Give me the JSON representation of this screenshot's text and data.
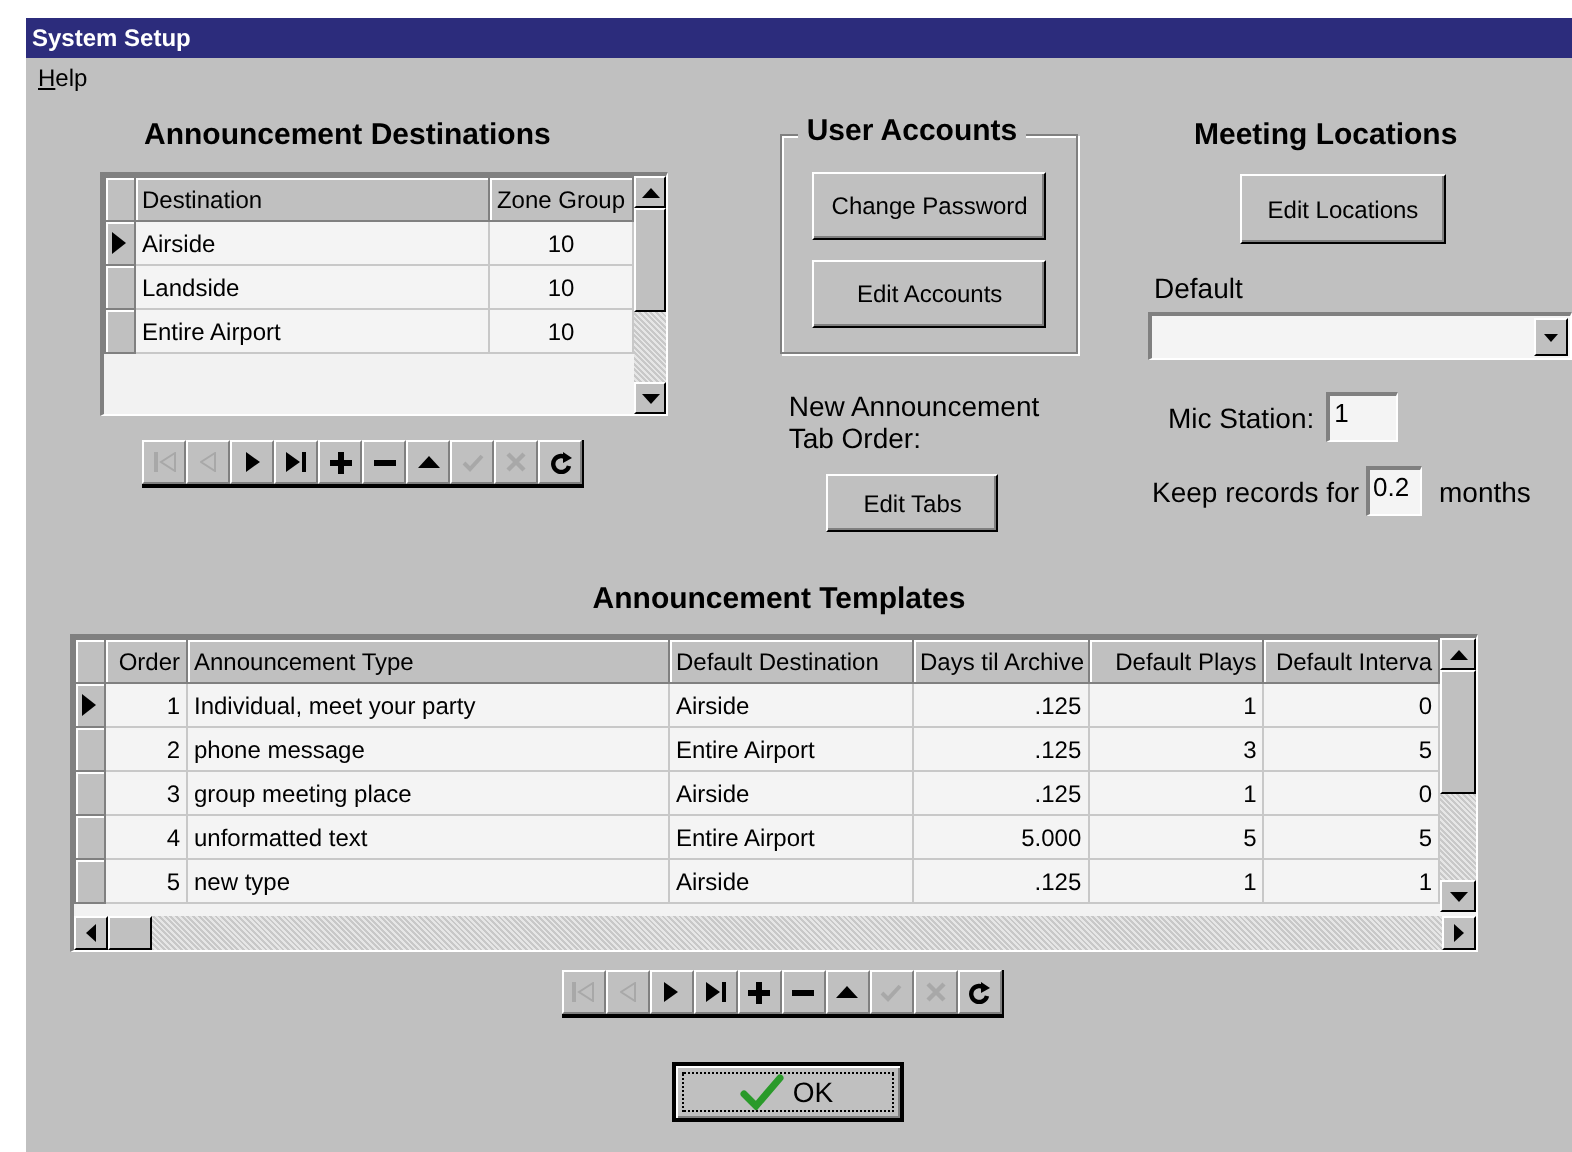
{
  "window": {
    "title": "System Setup"
  },
  "menu": [
    {
      "label": "Help"
    }
  ],
  "destinations": {
    "title": "Announcement Destinations",
    "columns": [
      {
        "label": "Destination",
        "kind": "text"
      },
      {
        "label": "Zone Group",
        "kind": "code"
      }
    ],
    "rows": [
      {
        "cells": [
          "Airside",
          "10"
        ],
        "selected": true
      },
      {
        "cells": [
          "Landside",
          "10"
        ],
        "selected": false
      },
      {
        "cells": [
          "Entire Airport",
          "10"
        ],
        "selected": false
      }
    ],
    "navigator": [
      {
        "kind": "first",
        "disabled": true
      },
      {
        "kind": "prior",
        "disabled": true
      },
      {
        "kind": "next",
        "disabled": false
      },
      {
        "kind": "last",
        "disabled": false
      },
      {
        "kind": "insert",
        "disabled": false
      },
      {
        "kind": "delete",
        "disabled": false
      },
      {
        "kind": "edit",
        "disabled": false
      },
      {
        "kind": "post",
        "disabled": true
      },
      {
        "kind": "cancel",
        "disabled": true
      },
      {
        "kind": "refresh",
        "disabled": false
      }
    ]
  },
  "user_accounts": {
    "title": "User Accounts",
    "buttons": [
      "Change Password",
      "Edit Accounts"
    ]
  },
  "tab_order": {
    "label": "New Announcement Tab Order:",
    "button": "Edit Tabs"
  },
  "meeting_locations": {
    "title": "Meeting Locations",
    "button": "Edit Locations",
    "default_label": "Default",
    "mic_station": {
      "label": "Mic Station:",
      "value": "1"
    },
    "keep_records": {
      "label": "Keep records for",
      "value": "0.2",
      "unit": "months"
    }
  },
  "templates": {
    "title": "Announcement Templates",
    "columns": [
      {
        "label": "Order",
        "kind": "number"
      },
      {
        "label": "Announcement Type",
        "kind": "text"
      },
      {
        "label": "Default Destination",
        "kind": "text"
      },
      {
        "label": "Days til Archive",
        "kind": "number"
      },
      {
        "label": "Default Plays",
        "kind": "number"
      },
      {
        "label": "Default Interva",
        "kind": "number"
      }
    ],
    "rows": [
      {
        "cells": [
          "1",
          "Individual, meet your party",
          "Airside",
          ".125",
          "1",
          "0"
        ],
        "selected": true
      },
      {
        "cells": [
          "2",
          "phone message",
          "Entire Airport",
          ".125",
          "3",
          "5"
        ],
        "selected": false
      },
      {
        "cells": [
          "3",
          "group meeting place",
          "Airside",
          ".125",
          "1",
          "0"
        ],
        "selected": false
      },
      {
        "cells": [
          "4",
          "unformatted text",
          "Entire Airport",
          "5.000",
          "5",
          "5"
        ],
        "selected": false
      },
      {
        "cells": [
          "5",
          "new type",
          "Airside",
          ".125",
          "1",
          "1"
        ],
        "selected": false
      }
    ],
    "navigator": [
      {
        "kind": "first",
        "disabled": true
      },
      {
        "kind": "prior",
        "disabled": true
      },
      {
        "kind": "next",
        "disabled": false
      },
      {
        "kind": "last",
        "disabled": false
      },
      {
        "kind": "insert",
        "disabled": false
      },
      {
        "kind": "delete",
        "disabled": false
      },
      {
        "kind": "edit",
        "disabled": false
      },
      {
        "kind": "post",
        "disabled": true
      },
      {
        "kind": "cancel",
        "disabled": true
      },
      {
        "kind": "refresh",
        "disabled": false
      }
    ]
  },
  "ok_button": "OK"
}
